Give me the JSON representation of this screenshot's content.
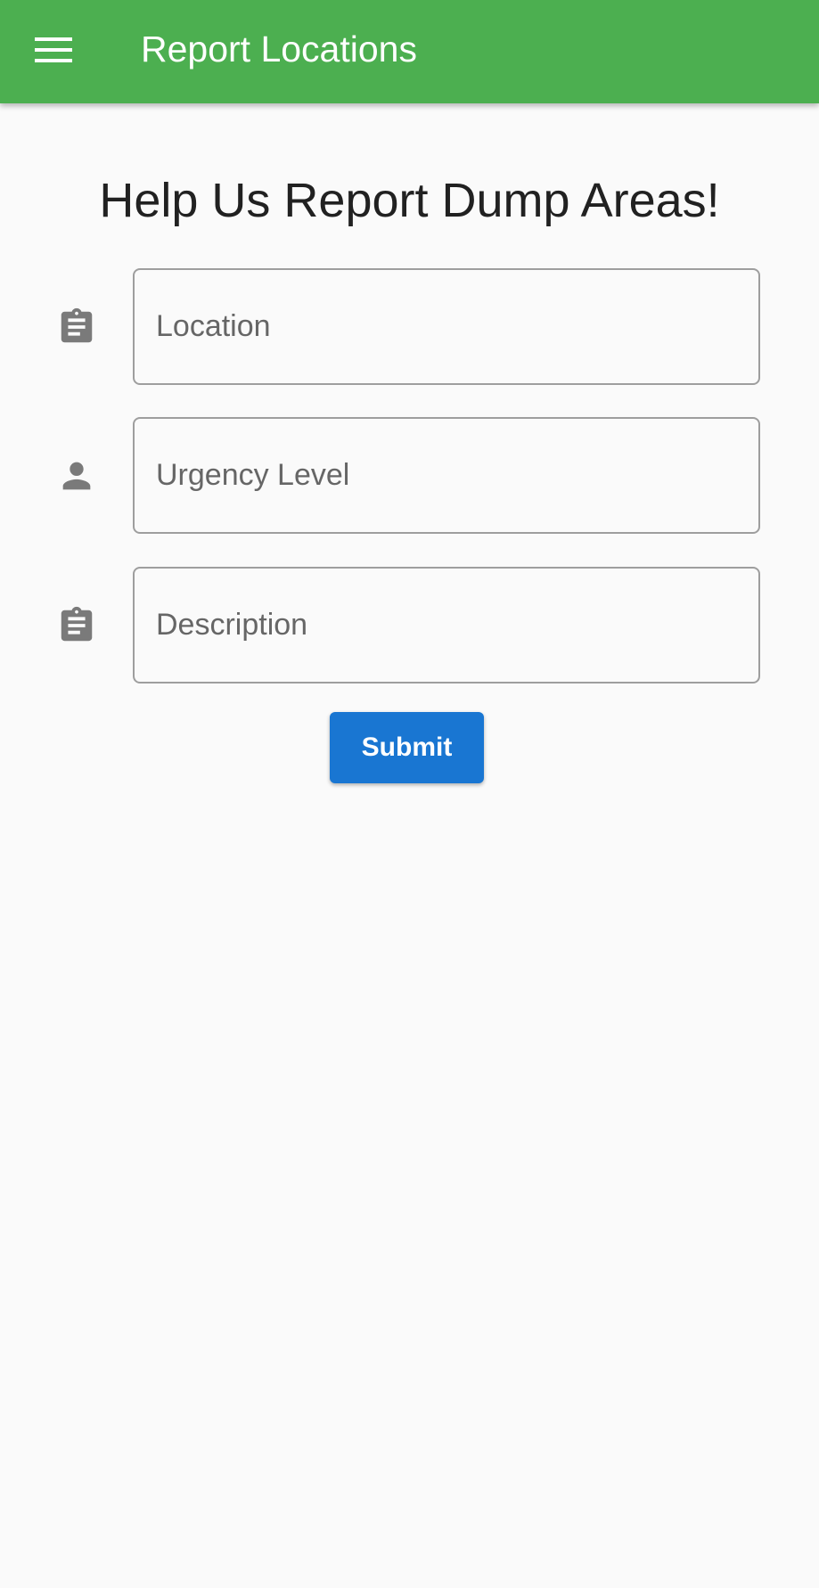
{
  "appbar": {
    "title": "Report Locations",
    "menu_icon": "menu-icon",
    "background_color": "#4caf50"
  },
  "form": {
    "heading": "Help Us Report Dump Areas!",
    "fields": [
      {
        "icon": "clipboard-icon",
        "value": "",
        "placeholder": "Location"
      },
      {
        "icon": "person-icon",
        "value": "",
        "placeholder": "Urgency Level"
      },
      {
        "icon": "clipboard-icon",
        "value": "",
        "placeholder": "Description"
      }
    ],
    "submit_label": "Submit",
    "submit_color": "#1976d2"
  }
}
